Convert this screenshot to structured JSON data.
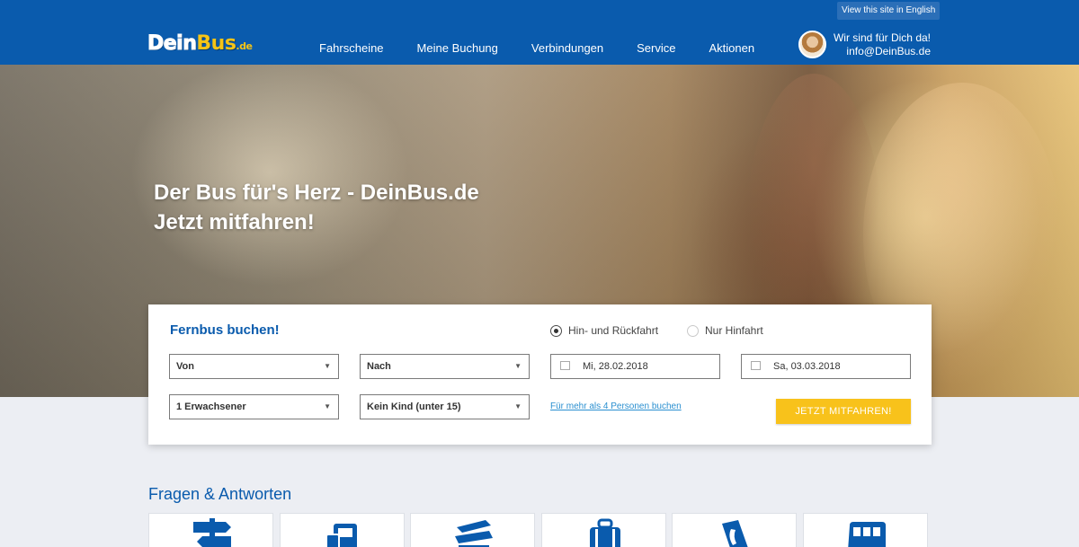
{
  "header": {
    "lang_button": "View this site in English",
    "logo": {
      "part1": "Dein",
      "part2": "Bus",
      "part3": ".de"
    },
    "nav": [
      "Fahrscheine",
      "Meine Buchung",
      "Verbindungen",
      "Service",
      "Aktionen"
    ],
    "contact": {
      "line1": "Wir sind für Dich da!",
      "line2": "info@DeinBus.de"
    }
  },
  "hero": {
    "line1": "Der Bus für's Herz - DeinBus.de",
    "line2": "Jetzt mitfahren!"
  },
  "booking": {
    "title": "Fernbus buchen!",
    "trip_types": [
      {
        "label": "Hin- und Rückfahrt",
        "selected": true
      },
      {
        "label": "Nur Hinfahrt",
        "selected": false
      }
    ],
    "from": "Von",
    "to": "Nach",
    "outbound_date": "Mi, 28.02.2018",
    "return_date": "Sa, 03.03.2018",
    "adults": "1 Erwachsener",
    "children": "Kein Kind (unter 15)",
    "more_persons_link": "Für mehr als 4 Personen buchen",
    "submit": "JETZT MITFAHREN!"
  },
  "faq": {
    "title": "Fragen & Antworten",
    "icons": [
      "signpost-icon",
      "ticket-icon",
      "bus-stack-icon",
      "luggage-icon",
      "phone-icon",
      "bus-icon"
    ]
  },
  "colors": {
    "brand_blue": "#0a5bad",
    "accent_yellow": "#f8c21b",
    "link_blue": "#2a8fd0"
  }
}
